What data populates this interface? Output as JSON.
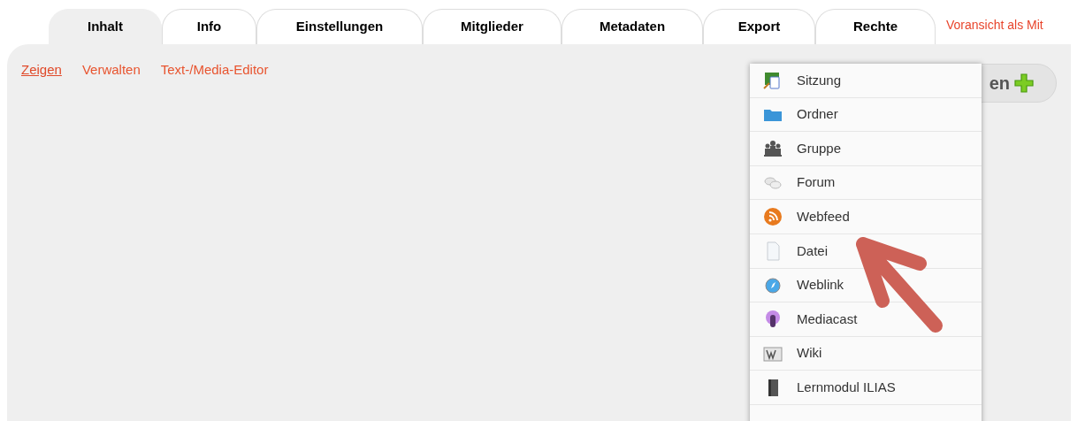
{
  "tabs": [
    {
      "label": "Inhalt",
      "selected": true
    },
    {
      "label": "Info",
      "selected": false
    },
    {
      "label": "Einstellungen",
      "selected": false
    },
    {
      "label": "Mitglieder",
      "selected": false
    },
    {
      "label": "Metadaten",
      "selected": false
    },
    {
      "label": "Export",
      "selected": false
    },
    {
      "label": "Rechte",
      "selected": false
    }
  ],
  "preview_link": "Voransicht als Mit",
  "subtabs": [
    {
      "label": "Zeigen",
      "selected": true
    },
    {
      "label": "Verwalten",
      "selected": false
    },
    {
      "label": "Text-/Media-Editor",
      "selected": false
    }
  ],
  "add_button": {
    "label": "en"
  },
  "add_menu": [
    {
      "kind": "session",
      "label": "Sitzung"
    },
    {
      "kind": "folder",
      "label": "Ordner"
    },
    {
      "kind": "group",
      "label": "Gruppe"
    },
    {
      "kind": "forum",
      "label": "Forum"
    },
    {
      "kind": "feed",
      "label": "Webfeed"
    },
    {
      "kind": "file",
      "label": "Datei"
    },
    {
      "kind": "weblink",
      "label": "Weblink"
    },
    {
      "kind": "mediacast",
      "label": "Mediacast"
    },
    {
      "kind": "wiki",
      "label": "Wiki"
    },
    {
      "kind": "module",
      "label": "Lernmodul ILIAS"
    }
  ]
}
